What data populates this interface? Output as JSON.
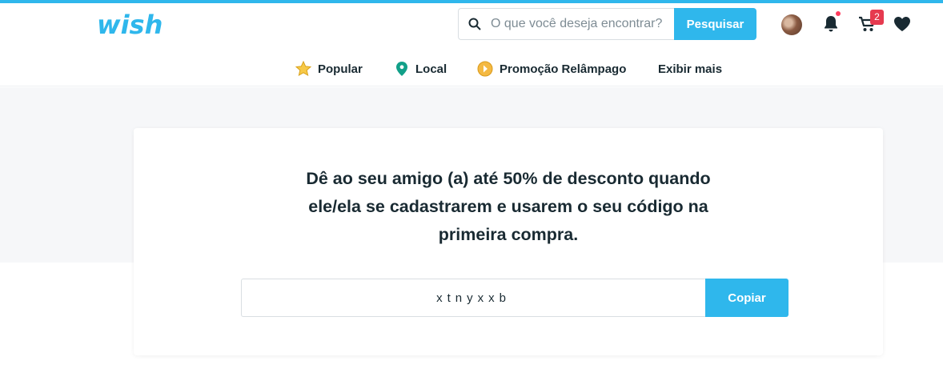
{
  "brand": {
    "logo_text": "wish",
    "accent": "#2fb7ec"
  },
  "search": {
    "placeholder": "O que você deseja encontrar?",
    "button_label": "Pesquisar",
    "icon": "search-icon"
  },
  "header_icons": {
    "avatar": "avatar",
    "notifications": {
      "icon": "bell-icon",
      "has_dot": true
    },
    "cart": {
      "icon": "cart-icon",
      "count": "2"
    },
    "wishlist": {
      "icon": "heart-icon"
    }
  },
  "nav": {
    "items": [
      {
        "label": "Popular",
        "icon": "star-icon"
      },
      {
        "label": "Local",
        "icon": "location-pin-icon"
      },
      {
        "label": "Promoção Relâmpago",
        "icon": "flash-deal-icon"
      },
      {
        "label": "Exibir mais"
      }
    ]
  },
  "referral": {
    "headline": "Dê ao seu amigo (a) até 50% de desconto quando ele/ela se cadastrarem e usarem o seu código na primeira compra.",
    "code": "xtnyxxb",
    "copy_label": "Copiar"
  }
}
